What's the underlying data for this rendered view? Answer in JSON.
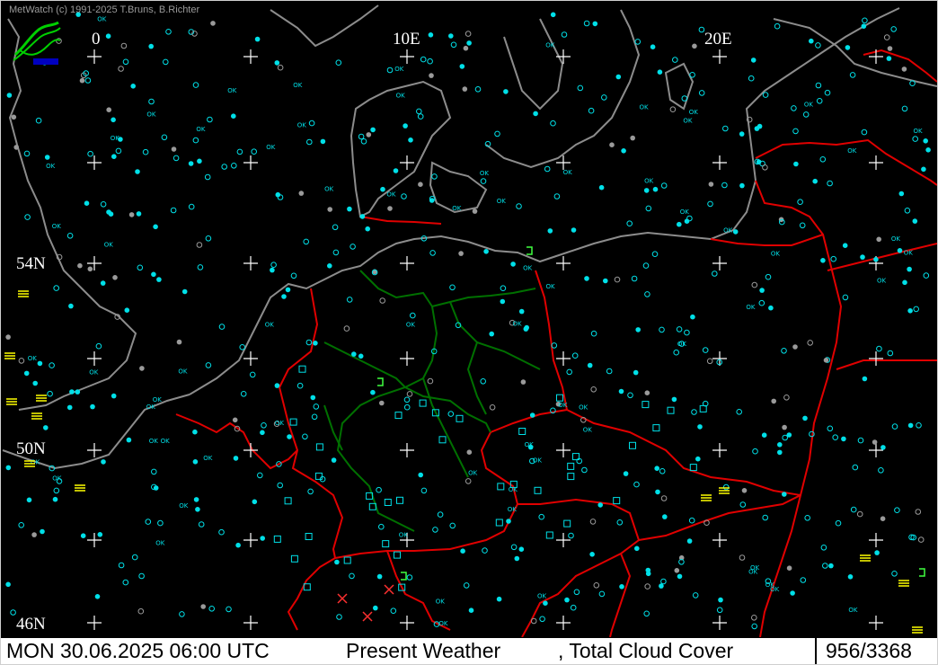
{
  "app": {
    "credit": "MetWatch  (c) 1991-2025 T.Bruns, B.Richter",
    "logo_icon": "metwatch-logo-icon"
  },
  "grid_labels": {
    "lon_0": "0",
    "lon_10e": "10E",
    "lon_20e": "20E",
    "lat_54n": "54N",
    "lat_50n": "50N",
    "lat_46n": "46N"
  },
  "status": {
    "datetime": "MON 30.06.2025 06:00 UTC",
    "parameter_1": "Present Weather",
    "parameter_2": ", Total Cloud Cover",
    "count": "956/3368"
  },
  "colors": {
    "background": "#000000",
    "coastline": "#8c8c8c",
    "country_border": "#e00000",
    "state_border": "#007000",
    "station_ok": "#00e0e8",
    "station_missing": "#9a9a9a",
    "weather_symbol": "#ffff00",
    "grid_cross": "#ffffff"
  }
}
